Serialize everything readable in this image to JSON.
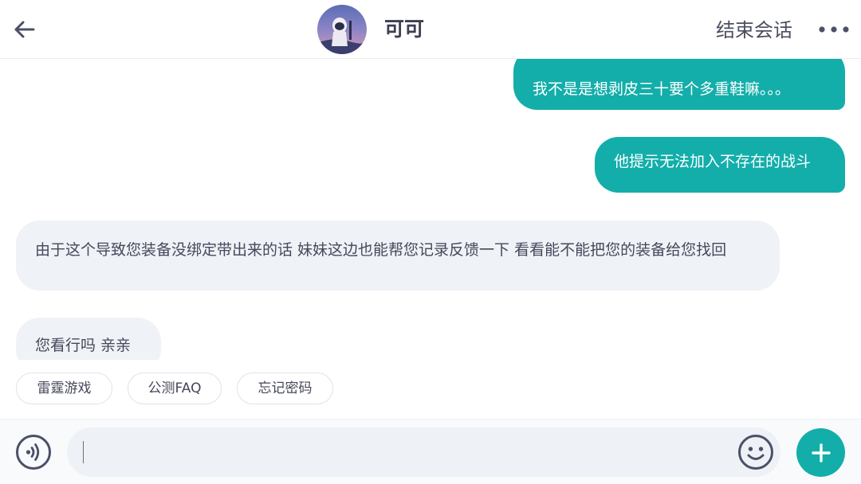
{
  "header": {
    "back_icon": "arrow-left-icon",
    "contact_name": "可可",
    "end_chat_label": "结束会话",
    "more_icon": "more-dots-icon"
  },
  "messages": [
    {
      "direction": "outgoing",
      "text": "我不是是想剥皮三十要个多重鞋嘛。。。"
    },
    {
      "direction": "outgoing",
      "text": "他提示无法加入不存在的战斗"
    },
    {
      "direction": "incoming",
      "text": "由于这个导致您装备没绑定带出来的话 妹妹这边也能帮您记录反馈一下 看看能不能把您的装备给您找回"
    },
    {
      "direction": "incoming",
      "text": "您看行吗 亲亲"
    }
  ],
  "quick_replies": [
    "雷霆游戏",
    "公测FAQ",
    "忘记密码"
  ],
  "input": {
    "value": "",
    "voice_icon": "voice-icon",
    "emoji_icon": "emoji-icon",
    "add_icon": "plus-icon"
  },
  "colors": {
    "accent": "#13aeaa",
    "incoming_bubble": "#eff2f6",
    "text_dark": "#45485a",
    "icon": "#4b5068"
  }
}
